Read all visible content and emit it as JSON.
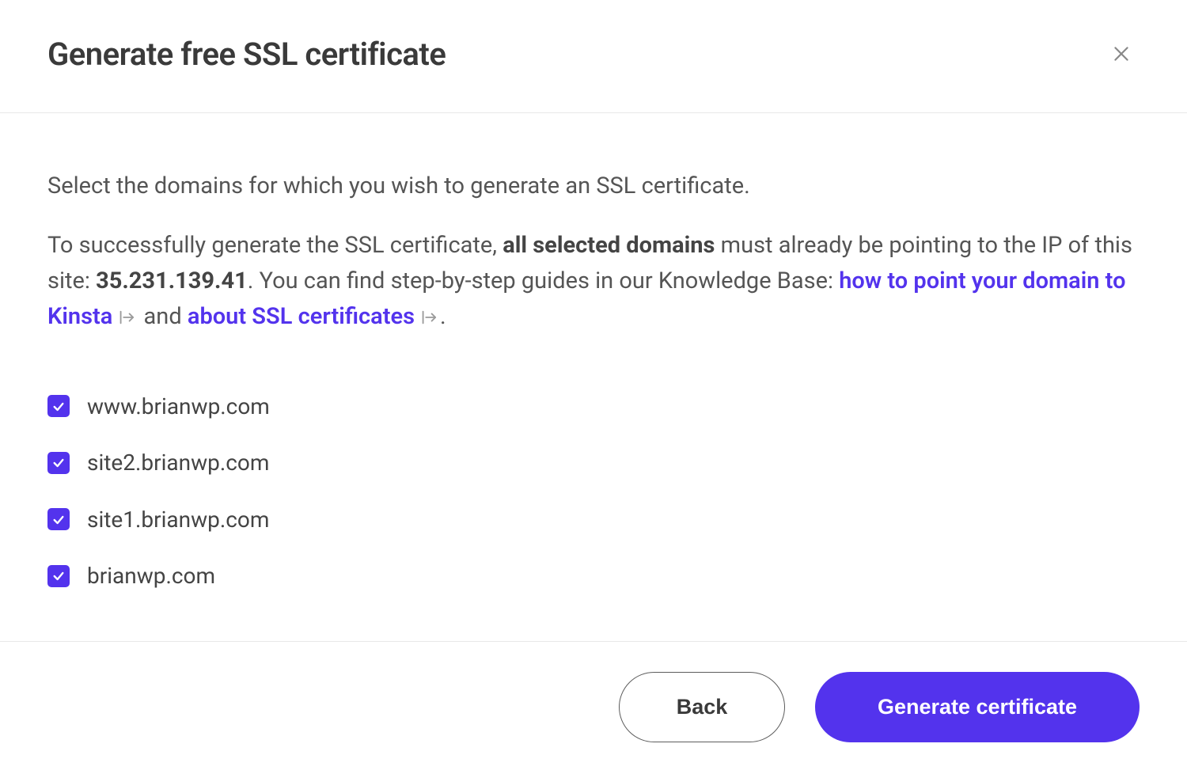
{
  "modal": {
    "title": "Generate free SSL certificate",
    "close_aria": "Close"
  },
  "body": {
    "intro": "Select the domains for which you wish to generate an SSL certificate.",
    "line_prefix": "To successfully generate the SSL certificate, ",
    "strong_domains": "all selected domains",
    "line_mid": " must already be pointing to the IP of this site: ",
    "ip": "35.231.139.41",
    "after_ip": ". You can find step-by-step guides in our Knowledge Base: ",
    "link1": "how to point your domain to Kinsta",
    "between_links": " and ",
    "link2": "about SSL certificates",
    "line_end": "."
  },
  "domains": [
    {
      "label": "www.brianwp.com",
      "checked": true
    },
    {
      "label": "site2.brianwp.com",
      "checked": true
    },
    {
      "label": "site1.brianwp.com",
      "checked": true
    },
    {
      "label": "brianwp.com",
      "checked": true
    }
  ],
  "footer": {
    "back": "Back",
    "generate": "Generate certificate"
  },
  "colors": {
    "accent": "#5333ed",
    "text": "#444444",
    "muted": "#9a9a9a",
    "border": "#e8e8e8"
  }
}
